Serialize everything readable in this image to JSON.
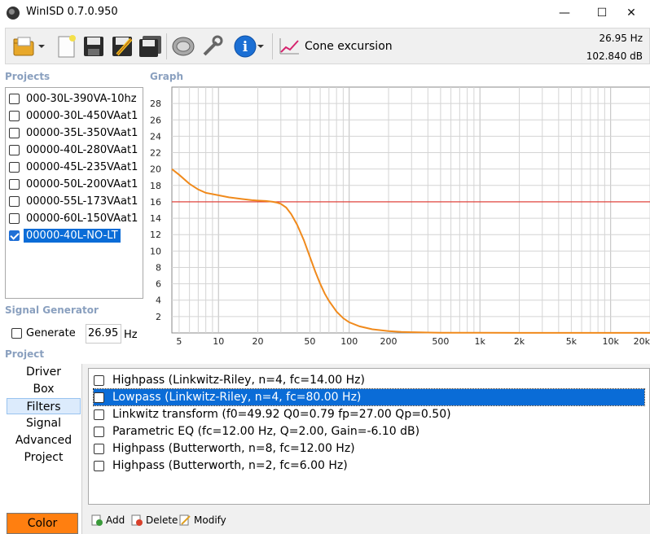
{
  "window": {
    "title": "WinISD 0.7.0.950",
    "minimize": "—",
    "maximize": "☐",
    "close": "✕"
  },
  "toolbar": {
    "buttons": [
      "open-folder-icon",
      "new-doc-icon",
      "save-icon",
      "edit-icon",
      "save-all-icon",
      "driver-icon",
      "tools-icon",
      "info-icon"
    ],
    "graph_selector": "Cone excursion",
    "readout_freq": "26.95 Hz",
    "readout_db": "102.840 dB"
  },
  "sections": {
    "projects": "Projects",
    "graph": "Graph",
    "signal_generator": "Signal Generator",
    "project": "Project"
  },
  "projects": [
    {
      "name": "000-30L-390VA-10hz",
      "checked": false
    },
    {
      "name": "00000-30L-450VAat1",
      "checked": false
    },
    {
      "name": "00000-35L-350VAat1",
      "checked": false
    },
    {
      "name": "00000-40L-280VAat1",
      "checked": false
    },
    {
      "name": "00000-45L-235VAat1",
      "checked": false
    },
    {
      "name": "00000-50L-200VAat1",
      "checked": false
    },
    {
      "name": "00000-55L-173VAat1",
      "checked": false
    },
    {
      "name": "00000-60L-150VAat1",
      "checked": false
    },
    {
      "name": "00000-40L-NO-LT",
      "checked": true,
      "selected": true
    }
  ],
  "signal_generator": {
    "generate_label": "Generate",
    "generate_checked": false,
    "frequency": "26.95",
    "unit": "Hz"
  },
  "project_nav": {
    "items": [
      "Driver",
      "Box",
      "Filters",
      "Signal",
      "Advanced",
      "Project"
    ],
    "active": "Filters",
    "color_button": "Color"
  },
  "filters": [
    {
      "label": "Highpass (Linkwitz-Riley, n=4, fc=14.00 Hz)",
      "checked": false
    },
    {
      "label": "Lowpass (Linkwitz-Riley, n=4, fc=80.00 Hz)",
      "checked": false,
      "selected": true
    },
    {
      "label": "Linkwitz transform (f0=49.92 Q0=0.79 fp=27.00 Qp=0.50)",
      "checked": false
    },
    {
      "label": "Parametric EQ (fc=12.00 Hz, Q=2.00, Gain=-6.10 dB)",
      "checked": false
    },
    {
      "label": "Highpass (Butterworth, n=8, fc=12.00 Hz)",
      "checked": false
    },
    {
      "label": "Highpass (Butterworth, n=2, fc=6.00 Hz)",
      "checked": false
    }
  ],
  "filter_actions": {
    "add": "Add",
    "delete": "Delete",
    "modify": "Modify"
  },
  "colors": {
    "curve": "#f08a1c",
    "limit_line": "#e0332a",
    "selection": "#0a6cd7",
    "project_color": "#ff7f10",
    "section_label": "#8aa0bf"
  },
  "chart_data": {
    "type": "line",
    "title": "",
    "xlabel": "",
    "ylabel": "",
    "x_scale": "log",
    "xlim": [
      4.4,
      20000
    ],
    "ylim": [
      0,
      30
    ],
    "grid": true,
    "x_tick_labels": [
      {
        "value": 5,
        "label": "5"
      },
      {
        "value": 10,
        "label": "10"
      },
      {
        "value": 20,
        "label": "20"
      },
      {
        "value": 50,
        "label": "50"
      },
      {
        "value": 100,
        "label": "100"
      },
      {
        "value": 200,
        "label": "200"
      },
      {
        "value": 500,
        "label": "500"
      },
      {
        "value": 1000,
        "label": "1k"
      },
      {
        "value": 2000,
        "label": "2k"
      },
      {
        "value": 5000,
        "label": "5k"
      },
      {
        "value": 10000,
        "label": "10k"
      },
      {
        "value": 20000,
        "label": "20k"
      }
    ],
    "y_ticks": [
      2,
      4,
      6,
      8,
      10,
      12,
      14,
      16,
      18,
      20,
      22,
      24,
      26,
      28
    ],
    "reference_line": {
      "y": 16
    },
    "series": [
      {
        "x": [
          4.4,
          5,
          6,
          7,
          8,
          10,
          12,
          15,
          18,
          20,
          23,
          26,
          28,
          30,
          33,
          36,
          40,
          45,
          50,
          55,
          60,
          65,
          70,
          80,
          90,
          100,
          120,
          150,
          200,
          250,
          300,
          400,
          500,
          700,
          1000,
          2000,
          5000,
          10000,
          20000
        ],
        "y": [
          20.0,
          19.3,
          18.2,
          17.5,
          17.1,
          16.8,
          16.55,
          16.35,
          16.2,
          16.15,
          16.1,
          16.0,
          15.9,
          15.75,
          15.3,
          14.5,
          13.2,
          11.3,
          9.3,
          7.5,
          6.0,
          4.8,
          3.9,
          2.6,
          1.8,
          1.3,
          0.8,
          0.45,
          0.22,
          0.13,
          0.09,
          0.05,
          0.03,
          0.02,
          0.02,
          0.01,
          0.01,
          0.01,
          0.01
        ]
      }
    ]
  }
}
